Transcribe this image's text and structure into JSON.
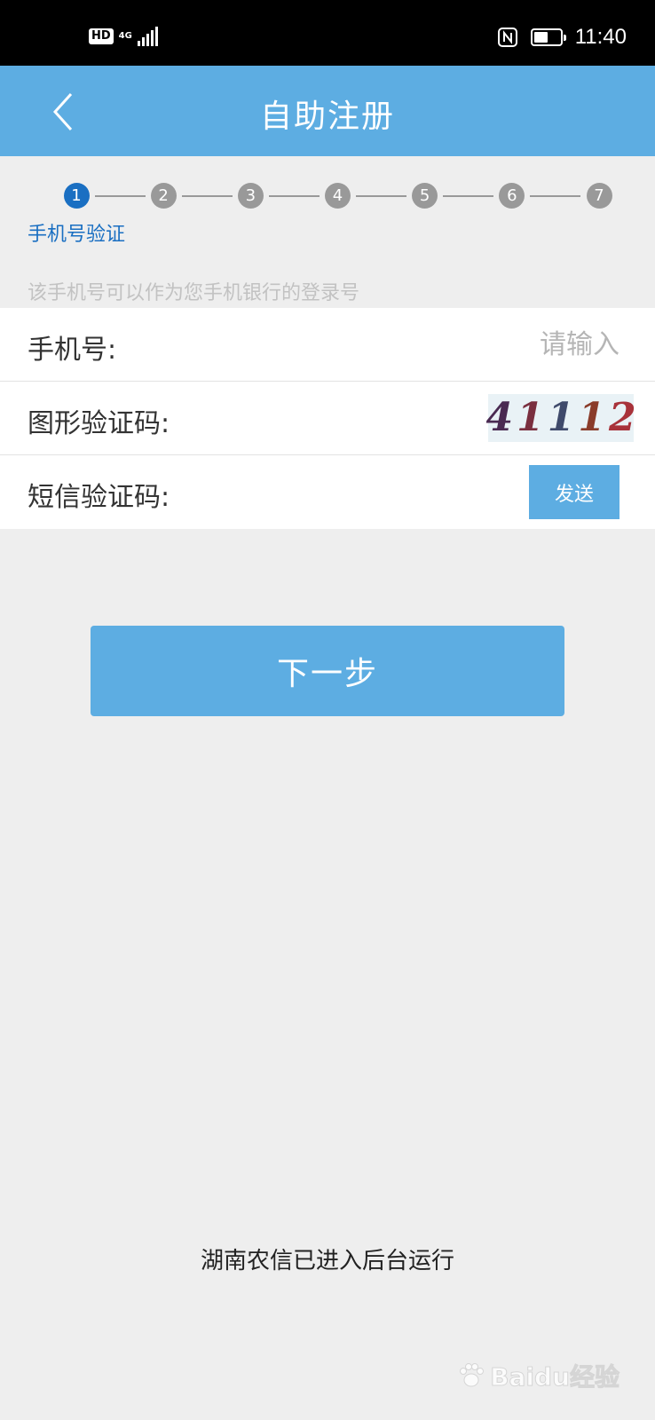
{
  "status_bar": {
    "hd": "HD",
    "network": "4G",
    "time": "11:40",
    "battery_level": 0.55
  },
  "header": {
    "title": "自助注册"
  },
  "stepper": {
    "steps": [
      "1",
      "2",
      "3",
      "4",
      "5",
      "6",
      "7"
    ],
    "active": 1,
    "current_label": "手机号验证"
  },
  "hint": "该手机号可以作为您手机银行的登录号",
  "form": {
    "phone_label": "手机号:",
    "phone_placeholder": "请输入",
    "captcha_label": "图形验证码:",
    "captcha_value": "41112",
    "captcha_colors": [
      "#4a2a52",
      "#7a2f3f",
      "#3f4a6b",
      "#8a3c2a",
      "#a8323a"
    ],
    "sms_label": "短信验证码:",
    "send_label": "发送"
  },
  "next_button": "下一步",
  "toast": "湖南农信已进入后台运行",
  "watermark": "Baidu经验",
  "colors": {
    "accent": "#5dade2",
    "active_step": "#1a6fc2",
    "inactive_step": "#999999"
  }
}
